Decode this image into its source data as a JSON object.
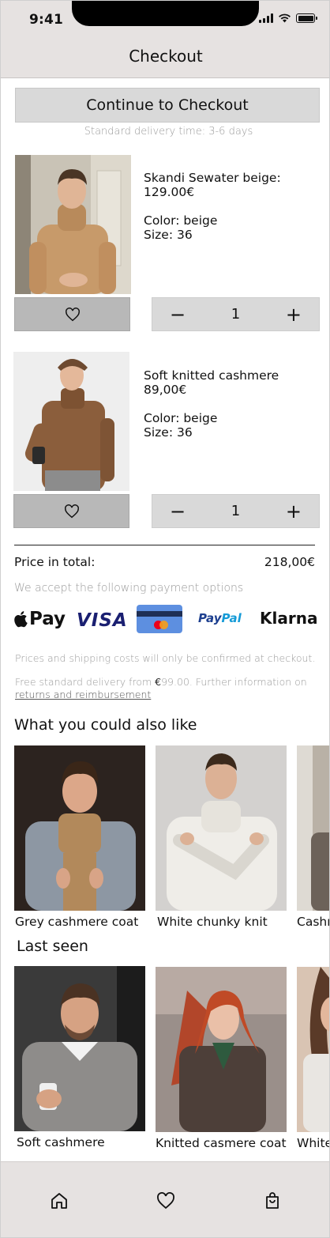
{
  "status_bar": {
    "time": "9:41"
  },
  "header": {
    "title": "Checkout"
  },
  "checkout": {
    "button_label": "Continue to Checkout",
    "delivery_note": "Standard delivery time: 3-6 days"
  },
  "cart_items": [
    {
      "name": "Skandi Sewater beige:",
      "price": "129.00€",
      "color": "Color: beige",
      "size": "Size: 36",
      "quantity": "1",
      "minus": "−",
      "plus": "+"
    },
    {
      "name": "Soft knitted cashmere",
      "price": "89,00€",
      "color": "Color: beige",
      "size": "Size: 36",
      "quantity": "1",
      "minus": "−",
      "plus": "+"
    }
  ],
  "total": {
    "label": "Price in total:",
    "value": "218,00€"
  },
  "payment": {
    "note": "We accept the following payment options",
    "methods": {
      "applepay": "Pay",
      "visa": "VISA",
      "paypal_1": "Pay",
      "paypal_2": "Pal",
      "klarna": "Klarna"
    },
    "mastercard_label": "mastercard"
  },
  "fine_print": {
    "line1": "Prices and shipping costs will only be confirmed at checkout.",
    "line2_start": "Free standard delivery from ",
    "line2_amount_symbol": "€",
    "line2_amount": "99.00",
    "line2_end": ". Further information on",
    "link": "returns and reimbursement"
  },
  "recommendations": {
    "title": "What you could also like",
    "items": [
      {
        "label": "Grey cashmere coat"
      },
      {
        "label": "White chunky knit"
      },
      {
        "label": "Cashm"
      }
    ]
  },
  "last_seen": {
    "title": "Last seen",
    "items": [
      {
        "label": "Soft cashmere"
      },
      {
        "label": "Knitted casmere coat"
      },
      {
        "label": "White"
      }
    ]
  },
  "nav": [
    "home-icon",
    "heart-icon",
    "bag-icon"
  ],
  "colors": {
    "header_bg": "#e6e2e1",
    "button_bg": "#d9d9d9",
    "favorite_bg": "#b8b8b8",
    "muted_text": "#9a9a9a"
  }
}
